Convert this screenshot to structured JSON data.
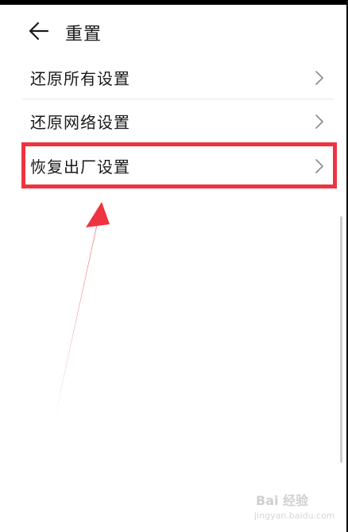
{
  "header": {
    "title": "重置",
    "back_icon": "arrow-left-icon"
  },
  "menu": {
    "items": [
      {
        "label": "还原所有设置",
        "icon": "chevron-right-icon"
      },
      {
        "label": "还原网络设置",
        "icon": "chevron-right-icon"
      },
      {
        "label": "恢复出厂设置",
        "icon": "chevron-right-icon"
      }
    ]
  },
  "annotation": {
    "color": "#ef3340",
    "highlighted_item": "恢复出厂设置"
  },
  "watermark": {
    "brand": "Bai 经验",
    "url": "jingyan.baidu.com"
  }
}
